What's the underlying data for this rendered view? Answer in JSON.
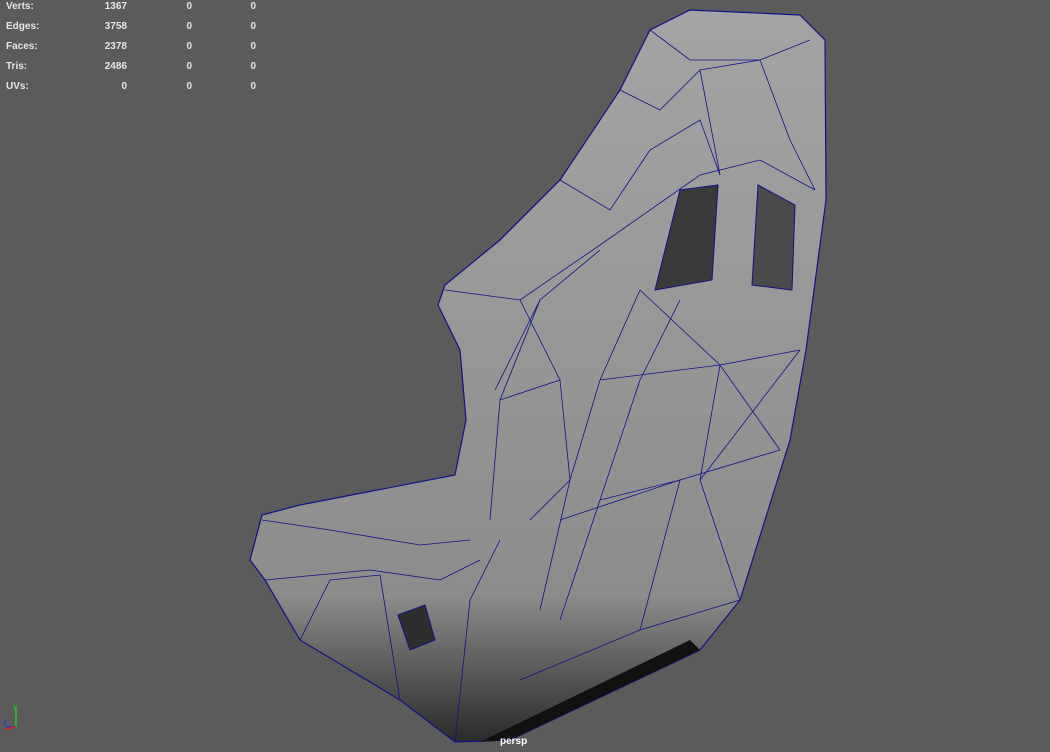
{
  "hud": {
    "rows": [
      {
        "label": "Verts:",
        "values": [
          "1367",
          "0",
          "0"
        ]
      },
      {
        "label": "Edges:",
        "values": [
          "3758",
          "0",
          "0"
        ]
      },
      {
        "label": "Faces:",
        "values": [
          "2378",
          "0",
          "0"
        ]
      },
      {
        "label": "Tris:",
        "values": [
          "2486",
          "0",
          "0"
        ]
      },
      {
        "label": "UVs:",
        "values": [
          "0",
          "0",
          "0"
        ]
      }
    ]
  },
  "viewport": {
    "camera_label": "persp",
    "background": "#5b5b5b",
    "wireframe_color": "#12128a",
    "mesh_color": "#9a9a9a",
    "axis": {
      "x_color": "#e02020",
      "y_color": "#20d020",
      "z_color": "#2030e0",
      "y_label": "y",
      "z_label": "z"
    }
  }
}
